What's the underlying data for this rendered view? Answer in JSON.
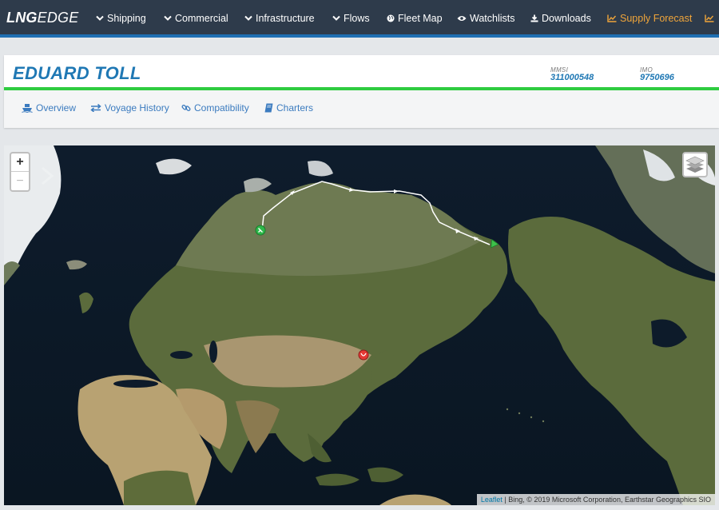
{
  "brand": {
    "bold": "LNG",
    "light": "EDGE"
  },
  "nav": {
    "items": [
      {
        "label": "Shipping",
        "icon": "chevron-down-icon"
      },
      {
        "label": "Commercial",
        "icon": "chevron-down-icon"
      },
      {
        "label": "Infrastructure",
        "icon": "chevron-down-icon"
      },
      {
        "label": "Flows",
        "icon": "chevron-down-icon"
      },
      {
        "label": "Fleet Map",
        "icon": "globe-icon"
      },
      {
        "label": "Watchlists",
        "icon": "eye-icon"
      },
      {
        "label": "Downloads",
        "icon": "download-icon"
      },
      {
        "label": "Supply Forecast",
        "icon": "line-chart-icon"
      }
    ]
  },
  "vessel": {
    "name": "EDUARD TOLL",
    "mmsi_label": "MMSI",
    "mmsi": "311000548",
    "imo_label": "IMO",
    "imo": "9750696"
  },
  "tabs": [
    {
      "label": "Overview",
      "icon": "ship-icon"
    },
    {
      "label": "Voyage History",
      "icon": "exchange-icon"
    },
    {
      "label": "Compatibility",
      "icon": "link-icon"
    },
    {
      "label": "Charters",
      "icon": "book-icon"
    }
  ],
  "map": {
    "zoom_in": "+",
    "zoom_out": "−",
    "attribution_link": "Leaflet",
    "attribution_text": " | Bing, © 2019 Microsoft Corporation, Earthstar Geographics SIO"
  },
  "colors": {
    "navbar": "#2e3b4b",
    "accent": "#1f78b4",
    "status_green": "#2ecc40",
    "supply_forecast": "#f0a53a"
  }
}
